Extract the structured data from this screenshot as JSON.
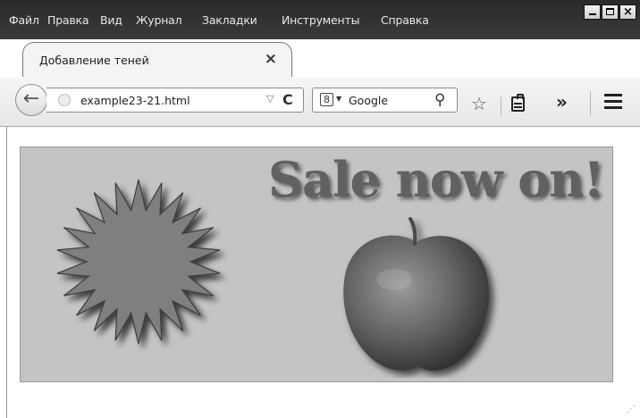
{
  "menu": {
    "items": [
      "Файл",
      "Правка",
      "Вид",
      "Журнал",
      "Закладки",
      "Инструменты",
      "Справка"
    ]
  },
  "window_controls": {
    "close_label": "×"
  },
  "tab": {
    "title": "Добавление теней",
    "close_glyph": "×"
  },
  "new_tab_glyph": "+",
  "navbar": {
    "back_glyph": "←",
    "url": "example23-21.html",
    "dropdown_glyph": "▽",
    "reload_glyph": "C",
    "search_engine_badge": "8",
    "search_engine_arrow": "▼",
    "search_engine_name": "Google",
    "search_glyph": "⚲",
    "bookmark_glyph": "☆",
    "overflow_glyph": "»"
  },
  "page": {
    "headline": "Sale now on!"
  },
  "icons": [
    "back-arrow-icon",
    "globe-icon",
    "reload-icon",
    "google-icon",
    "magnifier-icon",
    "star-icon",
    "reading-list-icon",
    "overflow-icon",
    "hamburger-menu-icon"
  ],
  "colors": {
    "menubar": "#2f2f2f",
    "stage_background": "#c4c4c4",
    "headline": "#616161",
    "burst_fill": "#7f7f7f",
    "apple": "#555555"
  }
}
